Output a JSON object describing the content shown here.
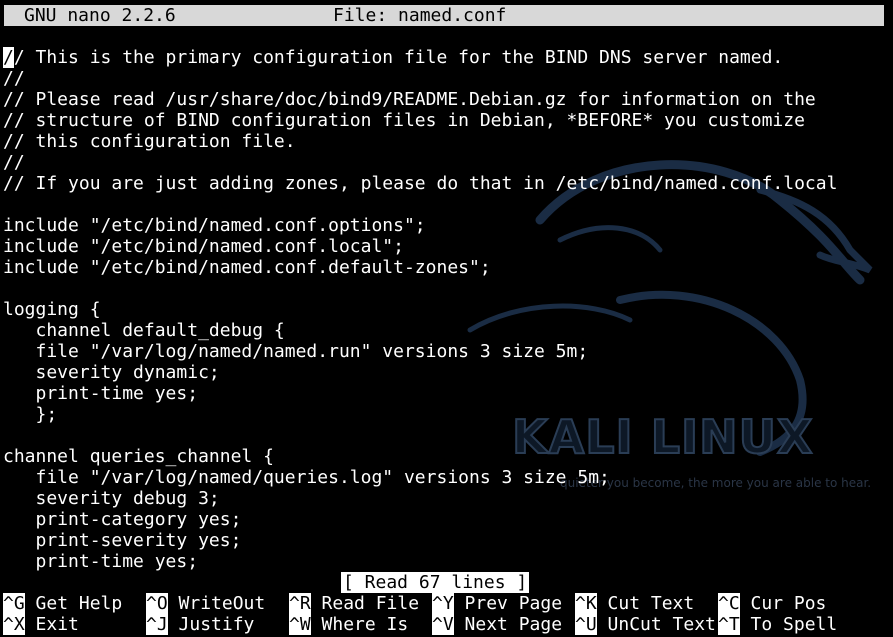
{
  "titlebar": {
    "app": "GNU nano 2.2.6",
    "file": "File: named.conf"
  },
  "editor": {
    "lines": [
      "// This is the primary configuration file for the BIND DNS server named.",
      "//",
      "// Please read /usr/share/doc/bind9/README.Debian.gz for information on the",
      "// structure of BIND configuration files in Debian, *BEFORE* you customize",
      "// this configuration file.",
      "//",
      "// If you are just adding zones, please do that in /etc/bind/named.conf.local",
      "",
      "include \"/etc/bind/named.conf.options\";",
      "include \"/etc/bind/named.conf.local\";",
      "include \"/etc/bind/named.conf.default-zones\";",
      "",
      "logging {",
      "   channel default_debug {",
      "   file \"/var/log/named/named.run\" versions 3 size 5m;",
      "   severity dynamic;",
      "   print-time yes;",
      "   };",
      "",
      "channel queries_channel {",
      "   file \"/var/log/named/queries.log\" versions 3 size 5m;",
      "   severity debug 3;",
      "   print-category yes;",
      "   print-severity yes;",
      "   print-time yes;"
    ]
  },
  "status": "[ Read 67 lines ]",
  "shortcuts": [
    [
      {
        "key": "^G",
        "label": " Get Help"
      },
      {
        "key": "^O",
        "label": " WriteOut"
      },
      {
        "key": "^R",
        "label": " Read File"
      },
      {
        "key": "^Y",
        "label": " Prev Page"
      },
      {
        "key": "^K",
        "label": " Cut Text"
      },
      {
        "key": "^C",
        "label": " Cur Pos"
      }
    ],
    [
      {
        "key": "^X",
        "label": " Exit"
      },
      {
        "key": "^J",
        "label": " Justify"
      },
      {
        "key": "^W",
        "label": " Where Is"
      },
      {
        "key": "^V",
        "label": " Next Page"
      },
      {
        "key": "^U",
        "label": " UnCut Text"
      },
      {
        "key": "^T",
        "label": " To Spell"
      }
    ]
  ],
  "wallpaper": {
    "brand": "KALI LINUX",
    "tagline": "quieter you become, the more you are able to hear."
  },
  "colors": {
    "background": "#000000",
    "text": "#ffffff",
    "titlebar": "#d8d8d8",
    "dragon": "#1a2c44"
  }
}
